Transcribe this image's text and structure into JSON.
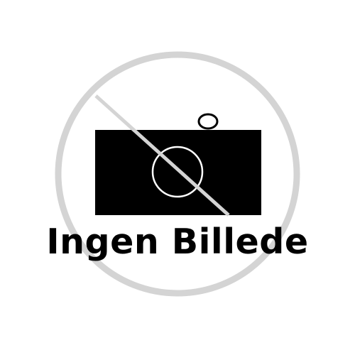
{
  "placeholder": {
    "caption": "Ingen Billede",
    "icon": "camera-off-icon",
    "colors": {
      "background": "#ffffff",
      "ring": "#d4d4d4",
      "camera_body": "#000000",
      "lens_stroke": "#ffffff",
      "text": "#000000"
    }
  }
}
